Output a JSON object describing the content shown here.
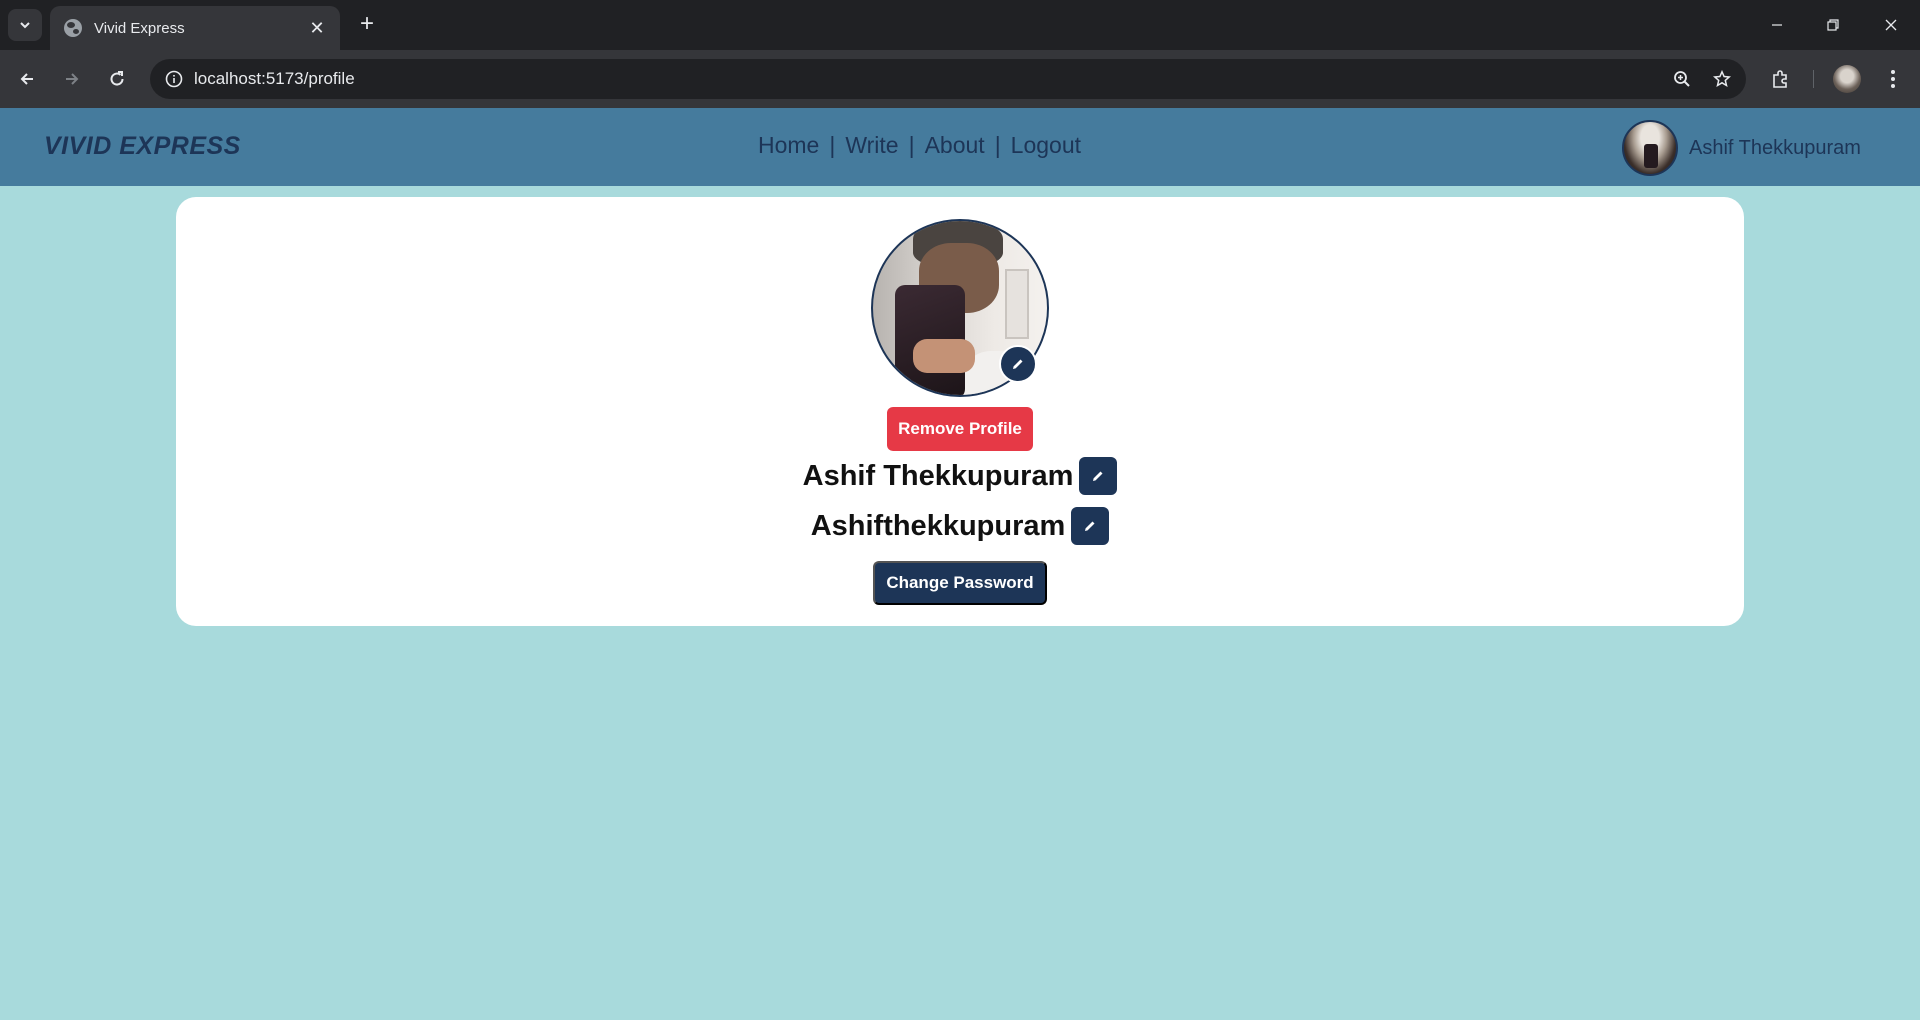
{
  "browser": {
    "tab_title": "Vivid Express",
    "tab_close": "✕",
    "new_tab": "+",
    "url": "localhost:5173/profile",
    "window_controls": {
      "minimize": "—",
      "restore": "❐",
      "close": "✕"
    }
  },
  "navbar": {
    "brand": "VIVID EXPRESS",
    "links": [
      "Home",
      "Write",
      "About",
      "Logout"
    ],
    "separator": "|",
    "user_name": "Ashif Thekkupuram"
  },
  "profile": {
    "remove_label": "Remove Profile",
    "full_name": "Ashif Thekkupuram",
    "username": "Ashifthekkupuram",
    "change_password_label": "Change Password"
  },
  "colors": {
    "page_bg": "#a8dadc",
    "navbar_bg": "#457b9d",
    "brand_text": "#1d3557",
    "danger": "#e63946",
    "primary": "#1d3557",
    "card_bg": "#ffffff"
  },
  "icons": [
    "chevron-down-icon",
    "globe-icon",
    "close-icon",
    "plus-icon",
    "back-icon",
    "forward-icon",
    "reload-icon",
    "info-icon",
    "zoom-icon",
    "star-icon",
    "extensions-icon",
    "menu-dots-icon",
    "pencil-icon"
  ]
}
